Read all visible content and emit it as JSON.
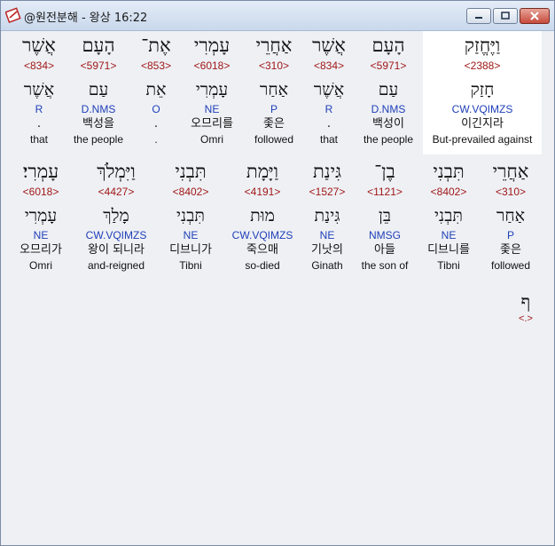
{
  "window": {
    "title": "@원전분해 - 왕상 16:22",
    "icon": "bible-app-icon",
    "controls": [
      "minimize-icon",
      "maximize-icon",
      "close-icon"
    ]
  },
  "row1": [
    {
      "heb1": "וַיֶּחֱזַק",
      "strong": "<2388>",
      "heb2": "חָזַק",
      "morph": "CW.VQIMZS",
      "kor": "이긴지라",
      "eng": "But-prevailed against",
      "highlight": true
    },
    {
      "heb1": "הָעָם",
      "strong": "<5971>",
      "heb2": "עַם",
      "morph": "D.NMS",
      "kor": "백성이",
      "eng": "the people"
    },
    {
      "heb1": "אֲשֶׁר",
      "strong": "<834>",
      "heb2": "אֲשֶׁר",
      "morph": "R",
      "kor": ".",
      "eng": "that"
    },
    {
      "heb1": "אַחֲרֵי",
      "strong": "<310>",
      "heb2": "אַחַר",
      "morph": "P",
      "kor": "좇은",
      "eng": "followed"
    },
    {
      "heb1": "עָמְרִי",
      "strong": "<6018>",
      "heb2": "עָמְרִי",
      "morph": "NE",
      "kor": "오므리를",
      "eng": "Omri"
    },
    {
      "heb1": "אֶת־",
      "strong": "<853>",
      "heb2": "אֵת",
      "morph": "O",
      "kor": ".",
      "eng": "."
    },
    {
      "heb1": "הָעָם",
      "strong": "<5971>",
      "heb2": "עַם",
      "morph": "D.NMS",
      "kor": "백성을",
      "eng": "the people"
    },
    {
      "heb1": "אֲשֶׁר",
      "strong": "<834>",
      "heb2": "אֲשֶׁר",
      "morph": "R",
      "kor": ".",
      "eng": "that"
    }
  ],
  "row2": [
    {
      "heb1": "אַחֲרֵי",
      "strong": "<310>",
      "heb2": "אַחַר",
      "morph": "P",
      "kor": "좇은",
      "eng": "followed"
    },
    {
      "heb1": "תִּבְנִי",
      "strong": "<8402>",
      "heb2": "תִּבְנִי",
      "morph": "NE",
      "kor": "디브니를",
      "eng": "Tibni"
    },
    {
      "heb1": "בֶן־",
      "strong": "<1121>",
      "heb2": "בֵּן",
      "morph": "NMSG",
      "kor": "아들",
      "eng": "the son of"
    },
    {
      "heb1": "גִּינַת",
      "strong": "<1527>",
      "heb2": "גִּינַת",
      "morph": "NE",
      "kor": "기낫의",
      "eng": "Ginath"
    },
    {
      "heb1": "וַיָּמָת",
      "strong": "<4191>",
      "heb2": "מוּת",
      "morph": "CW.VQIMZS",
      "kor": "죽으매",
      "eng": "so-died"
    },
    {
      "heb1": "תִּבְנִי",
      "strong": "<8402>",
      "heb2": "תִּבְנִי",
      "morph": "NE",
      "kor": "디브니가",
      "eng": "Tibni"
    },
    {
      "heb1": "וַיִּמְלֹךְ",
      "strong": "<4427>",
      "heb2": "מָלַךְ",
      "morph": "CW.VQIMZS",
      "kor": "왕이 되니라",
      "eng": "and-reigned"
    },
    {
      "heb1": "עָמְרִי׃",
      "strong": "<6018>",
      "heb2": "עָמְרִי",
      "morph": "NE",
      "kor": "오므리가",
      "eng": "Omri"
    }
  ],
  "end_mark": {
    "heb": "ף",
    "label": "<.>"
  }
}
